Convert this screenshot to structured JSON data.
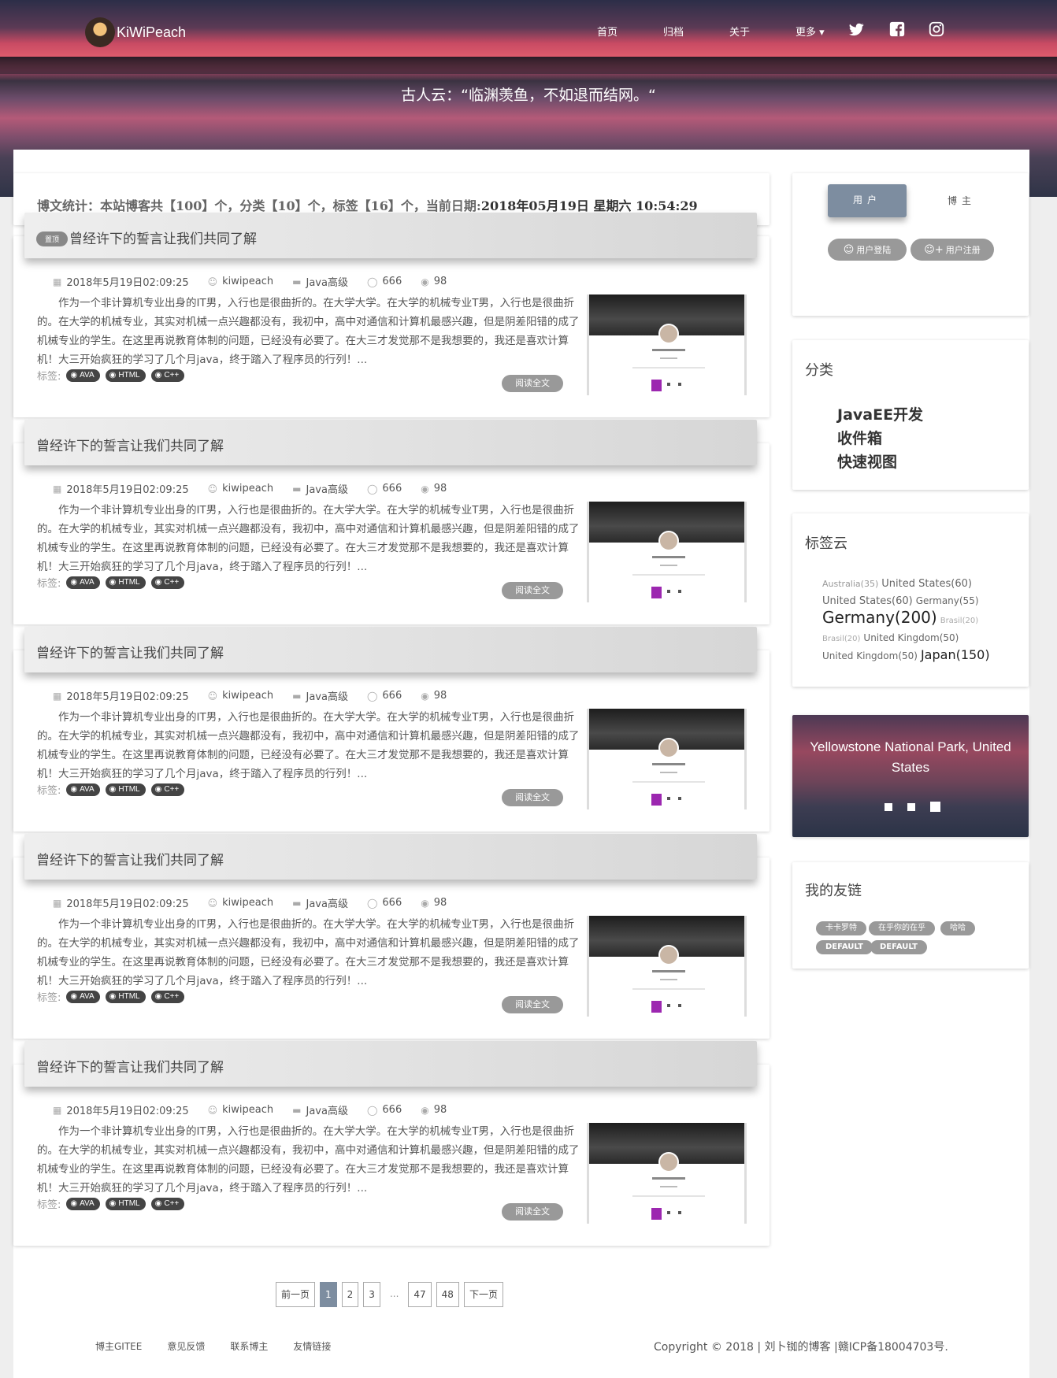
{
  "header": {
    "brand": "KiWiPeach",
    "nav": [
      "首页",
      "归档",
      "关于",
      "更多 ▾"
    ],
    "quote": "古人云：“临渊羡鱼，不如退而结网。“"
  },
  "stats": {
    "text": "博文统计：本站博客共【100】个，分类【10】个，标签【16】个，当前日期:",
    "now": "2018年05月19日 星期六 10:54:29"
  },
  "posts": [
    {
      "pinned": true,
      "pin_label": "置顶",
      "title": "曾经许下的誓言让我们共同了解",
      "date": "2018年5月19日02:09:25",
      "author": "kiwipeach",
      "category": "Java高级",
      "comments": "666",
      "views": "98",
      "summary": "作为一个非计算机专业出身的IT男，入行也是很曲折的。在大学大学。在大学的机械专业T男，入行也是很曲折的。在大学的机械专业，其实对机械一点兴趣都没有，我初中，高中对通信和计算机最感兴趣，但是阴差阳错的成了机械专业的学生。在这里再说教育体制的问题，已经没有必要了。在大三才发觉那不是我想要的，我还是喜欢计算机！大三开始疯狂的学习了几个月java，终于踏入了程序员的行列！...",
      "tags_label": "标签:",
      "tags": [
        "AVA",
        "HTML",
        "C++"
      ],
      "read_more": "阅读全文"
    },
    {
      "pinned": false,
      "pin_label": "",
      "title": "曾经许下的誓言让我们共同了解",
      "date": "2018年5月19日02:09:25",
      "author": "kiwipeach",
      "category": "Java高级",
      "comments": "666",
      "views": "98",
      "summary": "作为一个非计算机专业出身的IT男，入行也是很曲折的。在大学大学。在大学的机械专业T男，入行也是很曲折的。在大学的机械专业，其实对机械一点兴趣都没有，我初中，高中对通信和计算机最感兴趣，但是阴差阳错的成了机械专业的学生。在这里再说教育体制的问题，已经没有必要了。在大三才发觉那不是我想要的，我还是喜欢计算机！大三开始疯狂的学习了几个月java，终于踏入了程序员的行列！...",
      "tags_label": "标签:",
      "tags": [
        "AVA",
        "HTML",
        "C++"
      ],
      "read_more": "阅读全文"
    },
    {
      "pinned": false,
      "pin_label": "",
      "title": "曾经许下的誓言让我们共同了解",
      "date": "2018年5月19日02:09:25",
      "author": "kiwipeach",
      "category": "Java高级",
      "comments": "666",
      "views": "98",
      "summary": "作为一个非计算机专业出身的IT男，入行也是很曲折的。在大学大学。在大学的机械专业T男，入行也是很曲折的。在大学的机械专业，其实对机械一点兴趣都没有，我初中，高中对通信和计算机最感兴趣，但是阴差阳错的成了机械专业的学生。在这里再说教育体制的问题，已经没有必要了。在大三才发觉那不是我想要的，我还是喜欢计算机！大三开始疯狂的学习了几个月java，终于踏入了程序员的行列！...",
      "tags_label": "标签:",
      "tags": [
        "AVA",
        "HTML",
        "C++"
      ],
      "read_more": "阅读全文"
    },
    {
      "pinned": false,
      "pin_label": "",
      "title": "曾经许下的誓言让我们共同了解",
      "date": "2018年5月19日02:09:25",
      "author": "kiwipeach",
      "category": "Java高级",
      "comments": "666",
      "views": "98",
      "summary": "作为一个非计算机专业出身的IT男，入行也是很曲折的。在大学大学。在大学的机械专业T男，入行也是很曲折的。在大学的机械专业，其实对机械一点兴趣都没有，我初中，高中对通信和计算机最感兴趣，但是阴差阳错的成了机械专业的学生。在这里再说教育体制的问题，已经没有必要了。在大三才发觉那不是我想要的，我还是喜欢计算机！大三开始疯狂的学习了几个月java，终于踏入了程序员的行列！...",
      "tags_label": "标签:",
      "tags": [
        "AVA",
        "HTML",
        "C++"
      ],
      "read_more": "阅读全文"
    },
    {
      "pinned": false,
      "pin_label": "",
      "title": "曾经许下的誓言让我们共同了解",
      "date": "2018年5月19日02:09:25",
      "author": "kiwipeach",
      "category": "Java高级",
      "comments": "666",
      "views": "98",
      "summary": "作为一个非计算机专业出身的IT男，入行也是很曲折的。在大学大学。在大学的机械专业T男，入行也是很曲折的。在大学的机械专业，其实对机械一点兴趣都没有，我初中，高中对通信和计算机最感兴趣，但是阴差阳错的成了机械专业的学生。在这里再说教育体制的问题，已经没有必要了。在大三才发觉那不是我想要的，我还是喜欢计算机！大三开始疯狂的学习了几个月java，终于踏入了程序员的行列！...",
      "tags_label": "标签:",
      "tags": [
        "AVA",
        "HTML",
        "C++"
      ],
      "read_more": "阅读全文"
    }
  ],
  "pagination": {
    "prev": "前一页",
    "pages": [
      "1",
      "2",
      "3",
      "...",
      "47",
      "48"
    ],
    "active": "1",
    "next": "下一页"
  },
  "footer": {
    "links": [
      "博主GITEE",
      "意见反馈",
      "联系博主",
      "友情链接"
    ],
    "copyright": "Copyright © 2018 | 刘卜铷的博客 |赣ICP备18004703号."
  },
  "sidebar": {
    "tabs": {
      "user": "用户",
      "blogger": "博主"
    },
    "login": "用户登陆",
    "register": "用户注册",
    "categories_title": "分类",
    "categories": [
      "JavaEE开发",
      "收件箱",
      "快速视图"
    ],
    "tagcloud_title": "标签云",
    "tagcloud": [
      {
        "text": "Australia(35)",
        "size": 11
      },
      {
        "text": "United States(60)",
        "size": 13
      },
      {
        "text": "United States(60)",
        "size": 13
      },
      {
        "text": "Germany(55)",
        "size": 12
      },
      {
        "text": "Germany(200)",
        "size": 20
      },
      {
        "text": "Brasil(20)",
        "size": 10
      },
      {
        "text": "Brasil(20)",
        "size": 10
      },
      {
        "text": "United Kingdom(50)",
        "size": 12
      },
      {
        "text": "United Kingdom(50)",
        "size": 12
      },
      {
        "text": "Japan(150)",
        "size": 16
      }
    ],
    "slider_caption": "Yellowstone National Park, United States",
    "friends_title": "我的友链",
    "friends": [
      "卡卡罗特",
      "在乎你的在乎",
      "哈哈",
      "DEFAULT",
      "DEFAULT"
    ]
  },
  "colors": {
    "accent": "#7d8da0",
    "tag_bg": "#444444",
    "pill_bg": "#999999"
  }
}
